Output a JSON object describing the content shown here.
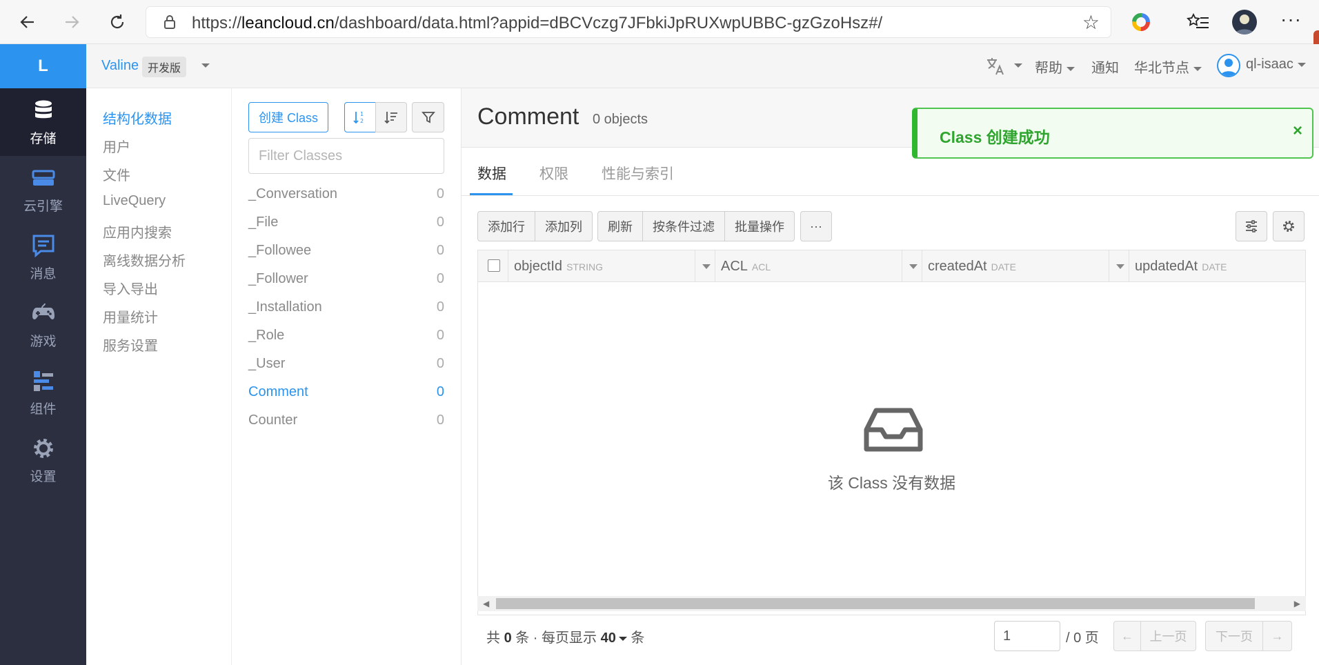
{
  "browser": {
    "url_prefix": "https://",
    "url_domain": "leancloud.cn",
    "url_rest": "/dashboard/data.html?appid=dBCVczg7JFbkiJpRUXwpUBBC-gzGzoHsz#/"
  },
  "app": {
    "logo_letter": "L",
    "name": "Valine",
    "plan_badge": "开发版",
    "topnav": {
      "help": "帮助",
      "notifications": "通知",
      "region": "华北节点",
      "user": "ql-isaac"
    }
  },
  "sidebar": {
    "items": [
      {
        "label": "存储",
        "icon": "database-icon"
      },
      {
        "label": "云引擎",
        "icon": "server-icon"
      },
      {
        "label": "消息",
        "icon": "message-icon"
      },
      {
        "label": "游戏",
        "icon": "gamepad-icon"
      },
      {
        "label": "组件",
        "icon": "components-icon"
      },
      {
        "label": "设置",
        "icon": "gear-icon"
      }
    ]
  },
  "submenu": {
    "items": [
      "结构化数据",
      "用户",
      "文件",
      "LiveQuery",
      "应用内搜索",
      "离线数据分析",
      "导入导出",
      "用量统计",
      "服务设置"
    ]
  },
  "classes": {
    "create_label": "创建 Class",
    "filter_placeholder": "Filter Classes",
    "list": [
      {
        "name": "_Conversation",
        "count": "0"
      },
      {
        "name": "_File",
        "count": "0"
      },
      {
        "name": "_Followee",
        "count": "0"
      },
      {
        "name": "_Follower",
        "count": "0"
      },
      {
        "name": "_Installation",
        "count": "0"
      },
      {
        "name": "_Role",
        "count": "0"
      },
      {
        "name": "_User",
        "count": "0"
      },
      {
        "name": "Comment",
        "count": "0"
      },
      {
        "name": "Counter",
        "count": "0"
      }
    ]
  },
  "main": {
    "class_name": "Comment",
    "object_count": "0 objects",
    "tabs": [
      "数据",
      "权限",
      "性能与索引"
    ],
    "toolbar": {
      "add_row": "添加行",
      "add_column": "添加列",
      "refresh": "刷新",
      "filter": "按条件过滤",
      "batch": "批量操作",
      "more": "···"
    },
    "columns": [
      {
        "name": "objectId",
        "type": "STRING"
      },
      {
        "name": "ACL",
        "type": "ACL"
      },
      {
        "name": "createdAt",
        "type": "DATE"
      },
      {
        "name": "updatedAt",
        "type": "DATE"
      }
    ],
    "empty_text": "该 Class 没有数据",
    "footer": {
      "total_prefix": "共",
      "total_count": "0",
      "total_mid": "条 · 每页显示",
      "page_size": "40",
      "total_suffix": "条",
      "page_value": "1",
      "page_total": "/ 0 页",
      "prev": "上一页",
      "next": "下一页"
    }
  },
  "toast": {
    "message": "Class 创建成功",
    "close": "×"
  },
  "colors": {
    "accent": "#2c94ee",
    "sidebar_bg": "#2c2f40",
    "success": "#2fa52f"
  }
}
